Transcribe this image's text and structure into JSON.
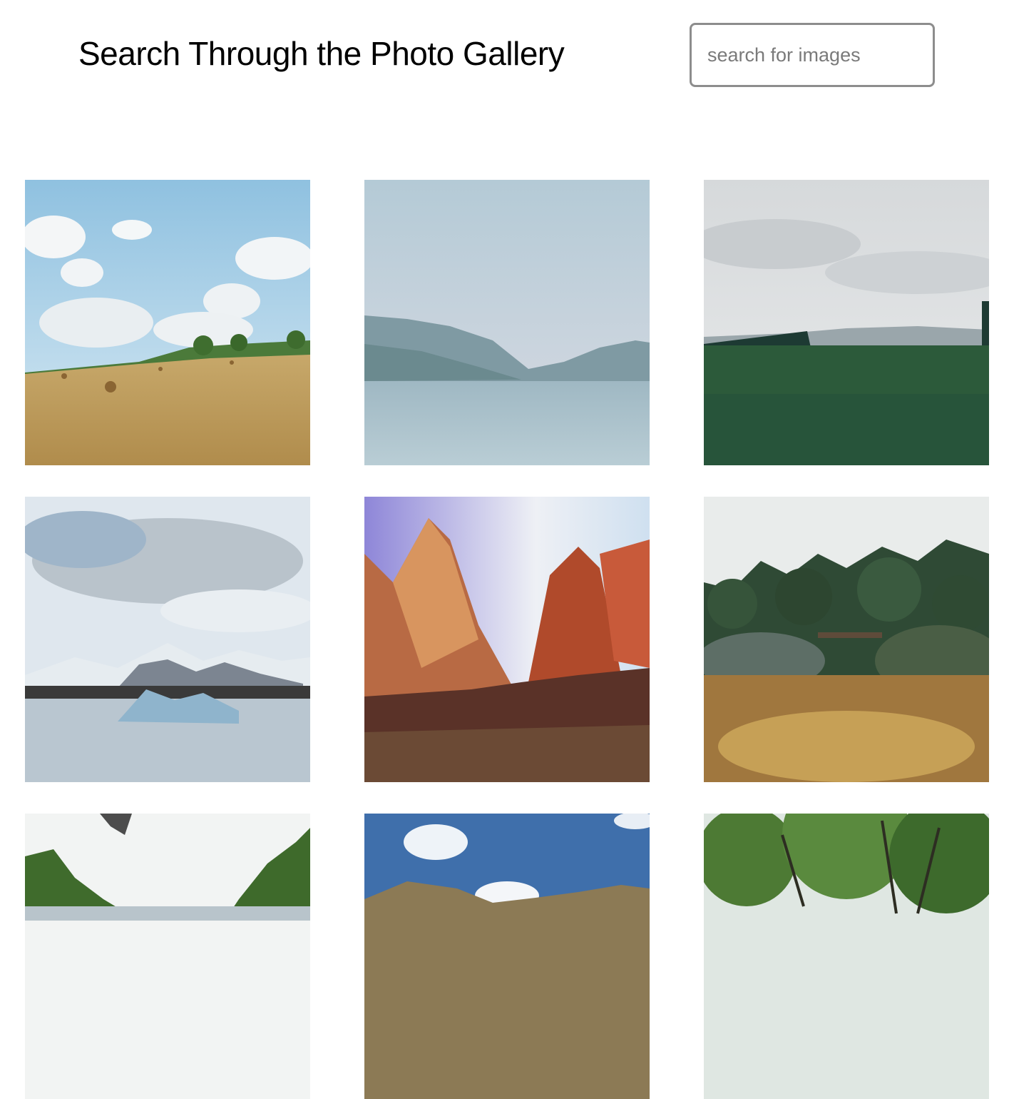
{
  "header": {
    "title": "Search Through the Photo Gallery"
  },
  "search": {
    "placeholder": "search for images",
    "value": ""
  },
  "gallery": {
    "images": [
      {
        "subject": "hay-field-with-bales"
      },
      {
        "subject": "lake-with-mountains"
      },
      {
        "subject": "green-plain-under-cloudy-sky"
      },
      {
        "subject": "glacier-lagoon-icebergs"
      },
      {
        "subject": "red-rock-canyon"
      },
      {
        "subject": "garden-with-pine-trees"
      },
      {
        "subject": "forest-canopy-sky"
      },
      {
        "subject": "blue-sky-with-dunes"
      },
      {
        "subject": "dense-tree-canopy"
      }
    ]
  }
}
